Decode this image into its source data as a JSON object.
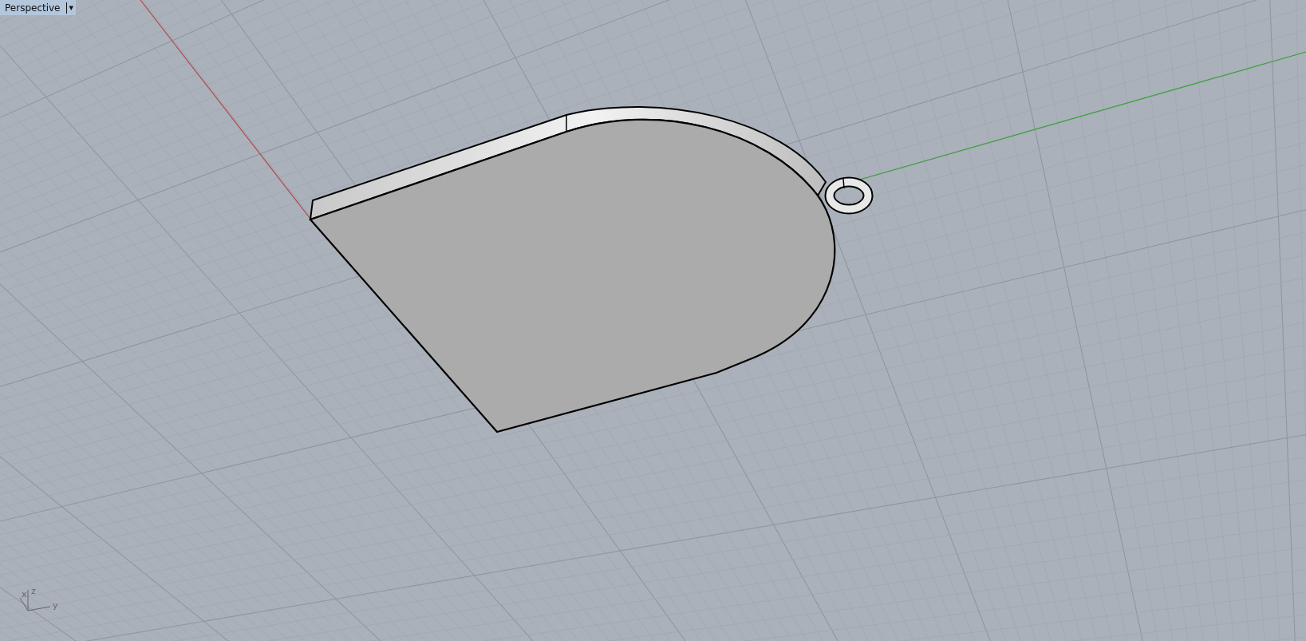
{
  "viewport": {
    "title": "Perspective",
    "menu_caret": "▾",
    "axes_widget": {
      "labels": [
        "x",
        "z",
        "y"
      ]
    }
  }
}
